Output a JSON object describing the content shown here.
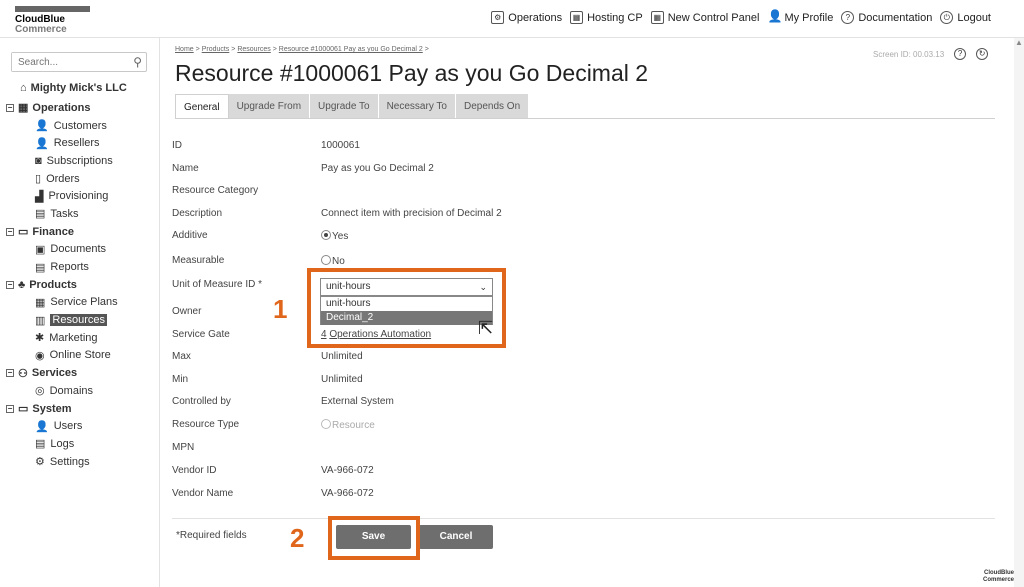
{
  "header": {
    "brand_line1": "CloudBlue",
    "brand_line2": "Commerce",
    "nav": [
      {
        "label": "Operations",
        "icon": "operations-icon"
      },
      {
        "label": "Hosting CP",
        "icon": "hosting-icon"
      },
      {
        "label": "New Control Panel",
        "icon": "panel-icon"
      },
      {
        "label": "My Profile",
        "icon": "profile-icon"
      },
      {
        "label": "Documentation",
        "icon": "docs-icon"
      },
      {
        "label": "Logout",
        "icon": "power-icon"
      }
    ]
  },
  "sidebar": {
    "search_placeholder": "Search...",
    "account": "Mighty Mick's LLC",
    "operations": {
      "label": "Operations",
      "items": [
        "Customers",
        "Resellers",
        "Subscriptions",
        "Orders",
        "Provisioning",
        "Tasks"
      ]
    },
    "finance": {
      "label": "Finance",
      "items": [
        "Documents",
        "Reports"
      ]
    },
    "products": {
      "label": "Products",
      "items": [
        "Service Plans",
        "Resources",
        "Marketing",
        "Online Store"
      ]
    },
    "services": {
      "label": "Services",
      "items": [
        "Domains"
      ]
    },
    "system": {
      "label": "System",
      "items": [
        "Users",
        "Logs",
        "Settings"
      ]
    }
  },
  "breadcrumb": {
    "home": "Home",
    "products": "Products",
    "resources": "Resources",
    "current": "Resource #1000061 Pay as you Go Decimal 2",
    "sep": ">"
  },
  "screen_id": "Screen ID: 00.03.13",
  "page_title": "Resource #1000061 Pay as you Go Decimal 2",
  "tabs": [
    "General",
    "Upgrade From",
    "Upgrade To",
    "Necessary To",
    "Depends On"
  ],
  "fields": {
    "id_label": "ID",
    "id_value": "1000061",
    "name_label": "Name",
    "name_value": "Pay as you Go Decimal 2",
    "category_label": "Resource Category",
    "description_label": "Description",
    "description_value": "Connect item with precision of Decimal 2",
    "additive_label": "Additive",
    "additive_value": "Yes",
    "measurable_label": "Measurable",
    "measurable_value": "No",
    "uom_label": "Unit of Measure ID *",
    "uom_value": "unit-hours",
    "uom_options": [
      "unit-hours",
      "Decimal_2"
    ],
    "owner_label": "Owner",
    "gate_label": "Service Gate",
    "gate_num": "4",
    "gate_link": "Operations Automation",
    "max_label": "Max",
    "max_value": "Unlimited",
    "min_label": "Min",
    "min_value": "Unlimited",
    "controlled_label": "Controlled by",
    "controlled_value": "External System",
    "type_label": "Resource Type",
    "type_value": "Resource",
    "mpn_label": "MPN",
    "vendor_id_label": "Vendor ID",
    "vendor_id_value": "VA-966-072",
    "vendor_name_label": "Vendor Name",
    "vendor_name_value": "VA-966-072"
  },
  "footer": {
    "required_note": "*Required fields",
    "save_label": "Save",
    "cancel_label": "Cancel"
  },
  "annotations": {
    "step1": "1",
    "step2": "2",
    "highlight_color": "#e0661c"
  },
  "bottom_brand": {
    "l1": "CloudBlue",
    "l2": "Commerce"
  }
}
